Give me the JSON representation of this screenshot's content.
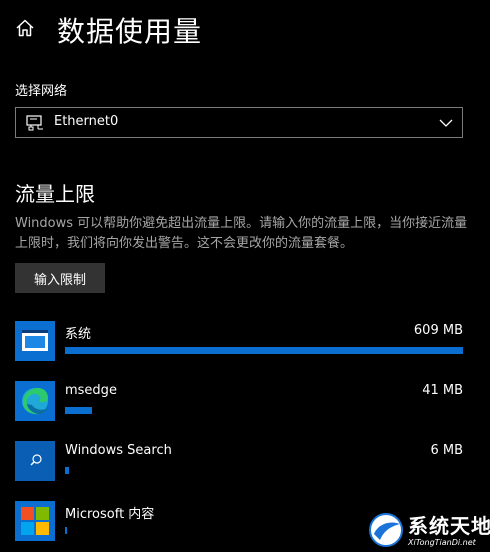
{
  "header": {
    "title": "数据使用量",
    "home_icon": "home-icon"
  },
  "network": {
    "label": "选择网络",
    "selected": "Ethernet0",
    "icon": "ethernet-icon"
  },
  "limit": {
    "title": "流量上限",
    "description": "Windows 可以帮助你避免超出流量上限。请输入你的流量上限，当你接近流量上限时，我们将向你发出警告。这不会更改你的流量套餐。",
    "button_label": "输入限制"
  },
  "apps": [
    {
      "name": "系统",
      "usage": "609 MB",
      "fraction": 1.0,
      "icon": "system-window-icon"
    },
    {
      "name": "msedge",
      "usage": "41 MB",
      "fraction": 0.068,
      "icon": "edge-icon"
    },
    {
      "name": "Windows Search",
      "usage": "6 MB",
      "fraction": 0.01,
      "icon": "search-icon"
    },
    {
      "name": "Microsoft 内容",
      "usage": "",
      "fraction": 0.005,
      "icon": "microsoft-logo-icon"
    }
  ],
  "watermark": {
    "text": "系统天地",
    "url": "XiTongTianDi.net"
  },
  "colors": {
    "accent": "#0a6fd1",
    "background": "#000000",
    "button": "#333333"
  }
}
